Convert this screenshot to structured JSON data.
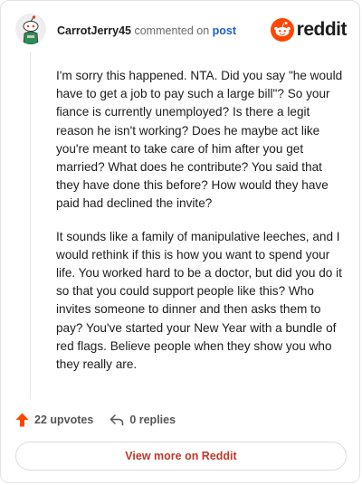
{
  "comment": {
    "author": "CarrotJerry45",
    "verb": "commented on",
    "target": "post",
    "paragraphs": [
      "I'm sorry this happened. NTA. Did you say \"he would have to get a job to pay such a large bill\"? So your fiance is currently unemployed? Is there a legit reason he isn't working? Does he maybe act like you're meant to take care of him after you get married? What does he contribute? You said that they have done this before? How would they have paid had declined the invite?",
      "It sounds like a family of manipulative leeches, and I would rethink if this is how you want to spend your life. You worked hard to be a doctor, but did you do it so that you could support people like this? Who invites someone to dinner and then asks them to pay? You've started your New Year with a bundle of red flags. Believe people when they show you who they really are."
    ],
    "upvotes": "22 upvotes",
    "replies": "0 replies"
  },
  "brand": {
    "wordmark": "reddit",
    "color": "#ff4500"
  },
  "footer": {
    "view_more_label": "View more on Reddit"
  },
  "icons": {
    "avatar": "snoo-avatar-icon",
    "logo": "reddit-logo-icon",
    "upvote": "upvote-arrow-icon",
    "reply": "reply-arrow-icon"
  },
  "colors": {
    "upvote": "#ff4500",
    "link": "#1c5fcf",
    "view_more": "#c0392b"
  }
}
